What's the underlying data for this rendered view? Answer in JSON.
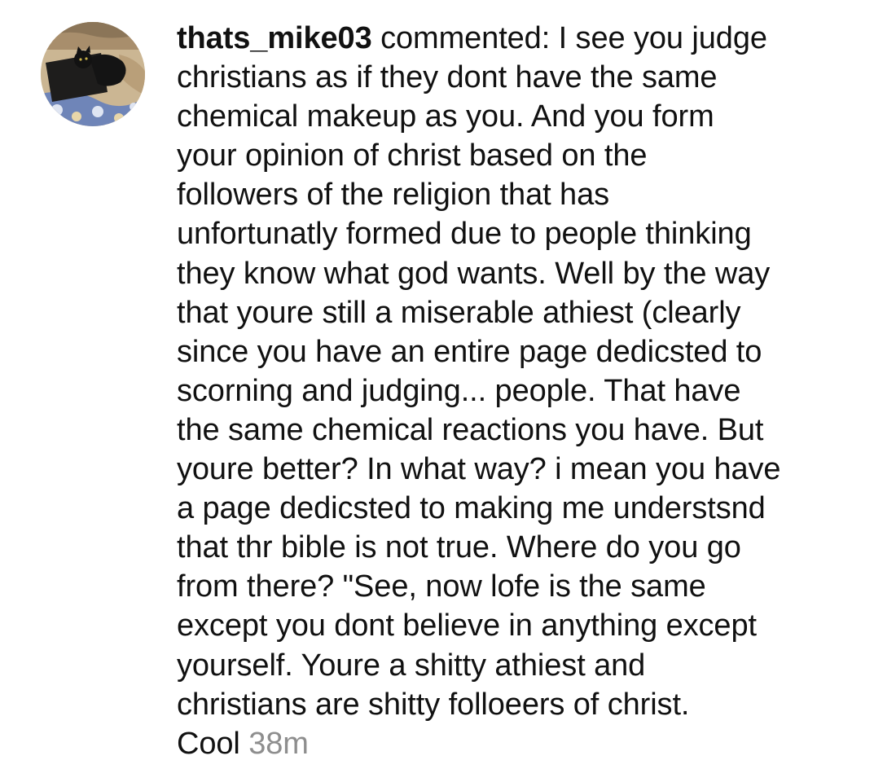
{
  "notification": {
    "username": "thats_mike03",
    "action": "commented:",
    "first_line_text": "I see you judge",
    "comment_lines": [
      "christians as if they dont have the same",
      "chemical makeup as you. And you form",
      "your opinion of christ based on the",
      "followers of the religion that has",
      "unfortunatly formed due to people thinking",
      "they know what god wants. Well by the way",
      "that youre still a miserable athiest (clearly",
      "since you have an entire page dedicsted to",
      "scorning and judging... people. That have",
      "the same chemical reactions you have. But",
      "youre better? In what way? i mean you have",
      "a page dedicsted to making me understsnd",
      "that thr bible is not true. Where do you go",
      "from there? \"See, now lofe is the same",
      "except you dont believe in anything except",
      "yourself. Youre a shitty athiest and",
      "christians are shitty folloeers of christ."
    ],
    "last_line_text": "Cool",
    "timestamp": "38m"
  },
  "colors": {
    "text": "#111111",
    "timestamp": "#8e8e8e",
    "background": "#ffffff"
  },
  "icons": {
    "avatar": "profile-photo-black-cat-on-blanket"
  }
}
